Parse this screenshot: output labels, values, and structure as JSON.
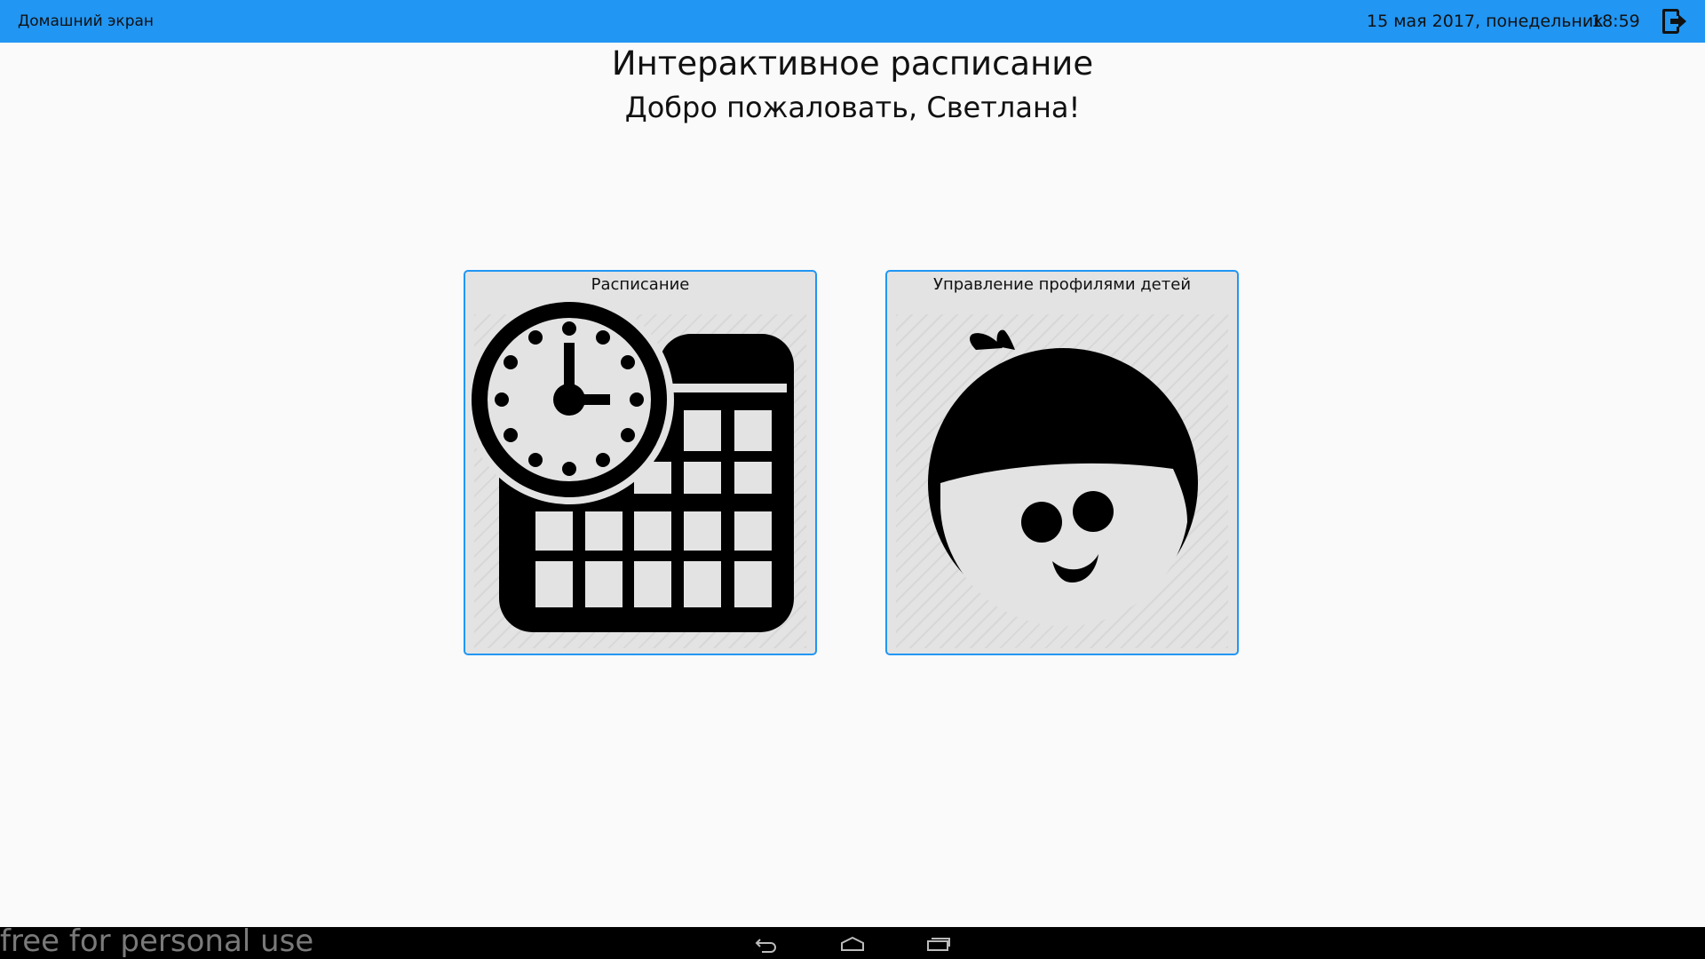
{
  "status_bar": {
    "screen_title": "Домашний экран",
    "date": "15 мая 2017, понедельник",
    "time": "18:59",
    "logout_icon": "logout-icon"
  },
  "header": {
    "title": "Интерактивное расписание",
    "welcome": "Добро пожаловать, Светлана!"
  },
  "tiles": [
    {
      "label": "Расписание",
      "icon": "clock-calendar-icon"
    },
    {
      "label": "Управление профилями детей",
      "icon": "child-face-icon"
    }
  ],
  "colors": {
    "accent": "#2196f3",
    "tile_background": "#e3e3e3",
    "navigation_bar": "#000000"
  },
  "watermark": "free for personal use",
  "navigation": {
    "back_icon": "back-icon",
    "home_icon": "home-icon",
    "recents_icon": "recents-icon"
  }
}
